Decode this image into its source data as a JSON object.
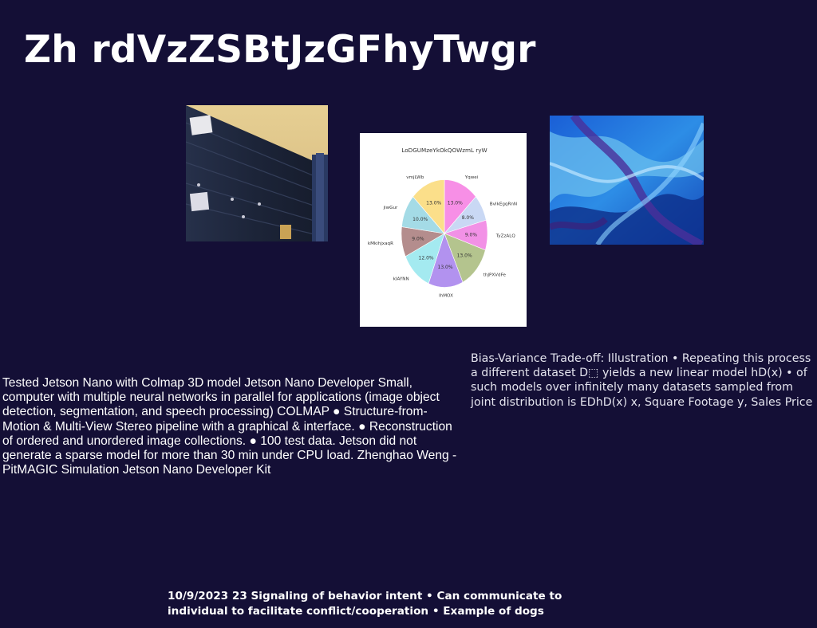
{
  "slide": {
    "title": "Zh rdVzZSBtJzGFhyTwgr",
    "left_text": "Tested Jetson Nano with Colmap 3D model Jetson Nano Developer Small, computer with multiple neural networks in parallel for applications (image object detection, segmentation, and speech processing) COLMAP ● Structure-from-Motion & Multi-View Stereo pipeline with a graphical & interface. ● Reconstruction of ordered and unordered image collections. ● 100 test data. Jetson did not generate a sparse model for more than 30 min under CPU load. Zhenghao Weng - PitMAGIC Simulation Jetson Nano Developer Kit",
    "right_text": "Bias-Variance Trade-off: Illustration • Repeating this process a different dataset D⬚ yields a new linear model hD(x) • of such models over infinitely many datasets sampled from joint distribution is EDhD(x) x, Square Footage y, Sales Price",
    "footer_text": "10/9/2023 23 Signaling of behavior intent • Can communicate to individual to facilitate conflict/cooperation • Example of dogs"
  },
  "chart_data": {
    "type": "pie",
    "title": "LoDGUMzeYkOkQOWzmL ryW",
    "categories": [
      "Yqwei",
      "BvIkEgqRnN",
      "TyZzALQ",
      "thJPXVdFe",
      "lhMOX",
      "kIAYNN",
      "kMkihjxaqR",
      "jiwGur",
      "vmjLWb"
    ],
    "values": [
      13.0,
      8.0,
      9.0,
      13.0,
      13.0,
      12.0,
      9.0,
      10.0,
      13.0
    ],
    "labels": [
      "13.0%",
      "8.0%",
      "9.0%",
      "13.0%",
      "13.0%",
      "12.0%",
      "9.0%",
      "10.0%",
      "13.0%"
    ],
    "colors": [
      "#f78fe6",
      "#c9d8f4",
      "#f291e6",
      "#b4c48e",
      "#b292ef",
      "#a4eaf0",
      "#b48d8d",
      "#a4dbe6",
      "#fbdf8a"
    ]
  },
  "photos": {
    "dock": "weathered dark wooden dock wall with signs",
    "texture": "blue abstract marbled texture"
  }
}
